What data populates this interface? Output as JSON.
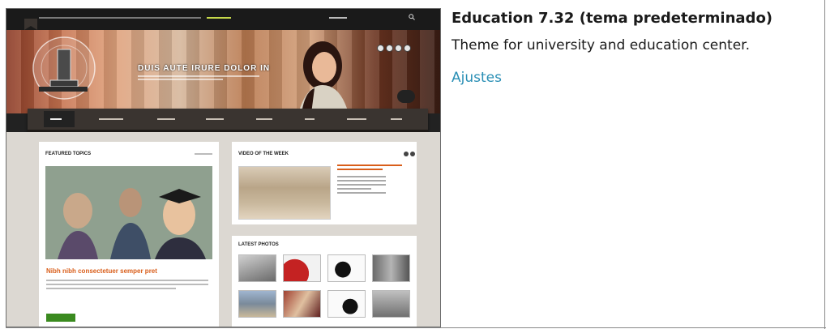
{
  "theme": {
    "name": "Education 7.32 (tema predeterminado)",
    "description": "Theme for university and education center.",
    "settings_link": "Ajustes"
  },
  "preview": {
    "hero_title": "DUIS AUTE IRURE DOLOR IN",
    "featured_heading": "FEATURED TOPICS",
    "featured_headline": "Nibh nibh consectetuer semper pret",
    "video_heading": "VIDEO OF THE WEEK",
    "photos_heading": "LATEST PHOTOS",
    "colors": {
      "accent_orange": "#d95e1a",
      "button_green": "#3a8a1f",
      "link_blue": "#2a8fb5"
    }
  }
}
